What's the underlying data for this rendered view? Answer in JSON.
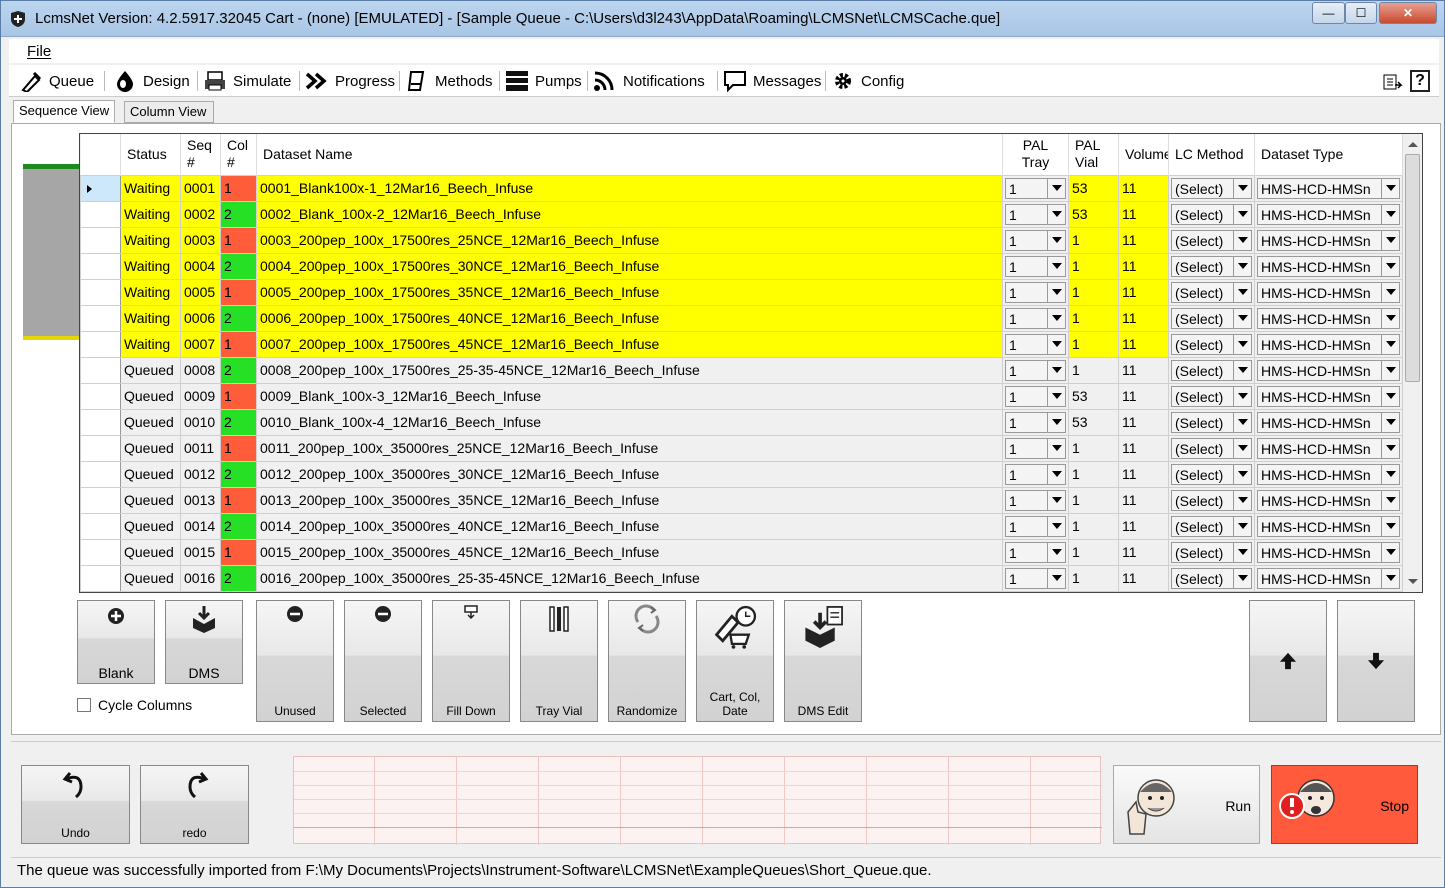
{
  "window": {
    "title": "LcmsNet Version: 4.2.5917.32045 Cart - (none) [EMULATED]  - [Sample Queue - C:\\Users\\d3l243\\AppData\\Roaming\\LCMSNet\\LCMSCache.que]",
    "minimize": "—",
    "maximize": "☐",
    "close": "✕"
  },
  "menu": {
    "file": "File"
  },
  "toolbar": {
    "queue": "Queue",
    "design": "Design",
    "simulate": "Simulate",
    "progress": "Progress",
    "methods": "Methods",
    "pumps": "Pumps",
    "notifications": "Notifications",
    "messages": "Messages",
    "config": "Config",
    "help": "?"
  },
  "tabs": {
    "sequence": "Sequence View",
    "column": "Column View"
  },
  "grid": {
    "headers": {
      "status": "Status",
      "seq": [
        "Seq",
        "#"
      ],
      "col": [
        "Col",
        "#"
      ],
      "dataset": "Dataset Name",
      "pal_tray": [
        "PAL",
        "Tray"
      ],
      "pal_vial": [
        "PAL",
        "Vial"
      ],
      "volume": "Volume",
      "lc_method": "LC Method",
      "dataset_type": "Dataset Type"
    },
    "rows": [
      {
        "status": "Waiting",
        "seq": "0001",
        "col": "1",
        "name": "0001_Blank100x-1_12Mar16_Beech_Infuse",
        "tray": "1",
        "vial": "53",
        "vol": "11",
        "method": "(Select)",
        "type": "HMS-HCD-HMSn"
      },
      {
        "status": "Waiting",
        "seq": "0002",
        "col": "2",
        "name": "0002_Blank_100x-2_12Mar16_Beech_Infuse",
        "tray": "1",
        "vial": "53",
        "vol": "11",
        "method": "(Select)",
        "type": "HMS-HCD-HMSn"
      },
      {
        "status": "Waiting",
        "seq": "0003",
        "col": "1",
        "name": "0003_200pep_100x_17500res_25NCE_12Mar16_Beech_Infuse",
        "tray": "1",
        "vial": "1",
        "vol": "11",
        "method": "(Select)",
        "type": "HMS-HCD-HMSn"
      },
      {
        "status": "Waiting",
        "seq": "0004",
        "col": "2",
        "name": "0004_200pep_100x_17500res_30NCE_12Mar16_Beech_Infuse",
        "tray": "1",
        "vial": "1",
        "vol": "11",
        "method": "(Select)",
        "type": "HMS-HCD-HMSn"
      },
      {
        "status": "Waiting",
        "seq": "0005",
        "col": "1",
        "name": "0005_200pep_100x_17500res_35NCE_12Mar16_Beech_Infuse",
        "tray": "1",
        "vial": "1",
        "vol": "11",
        "method": "(Select)",
        "type": "HMS-HCD-HMSn"
      },
      {
        "status": "Waiting",
        "seq": "0006",
        "col": "2",
        "name": "0006_200pep_100x_17500res_40NCE_12Mar16_Beech_Infuse",
        "tray": "1",
        "vial": "1",
        "vol": "11",
        "method": "(Select)",
        "type": "HMS-HCD-HMSn"
      },
      {
        "status": "Waiting",
        "seq": "0007",
        "col": "1",
        "name": "0007_200pep_100x_17500res_45NCE_12Mar16_Beech_Infuse",
        "tray": "1",
        "vial": "1",
        "vol": "11",
        "method": "(Select)",
        "type": "HMS-HCD-HMSn"
      },
      {
        "status": "Queued",
        "seq": "0008",
        "col": "2",
        "name": "0008_200pep_100x_17500res_25-35-45NCE_12Mar16_Beech_Infuse",
        "tray": "1",
        "vial": "1",
        "vol": "11",
        "method": "(Select)",
        "type": "HMS-HCD-HMSn"
      },
      {
        "status": "Queued",
        "seq": "0009",
        "col": "1",
        "name": "0009_Blank_100x-3_12Mar16_Beech_Infuse",
        "tray": "1",
        "vial": "53",
        "vol": "11",
        "method": "(Select)",
        "type": "HMS-HCD-HMSn"
      },
      {
        "status": "Queued",
        "seq": "0010",
        "col": "2",
        "name": "0010_Blank_100x-4_12Mar16_Beech_Infuse",
        "tray": "1",
        "vial": "53",
        "vol": "11",
        "method": "(Select)",
        "type": "HMS-HCD-HMSn"
      },
      {
        "status": "Queued",
        "seq": "0011",
        "col": "1",
        "name": "0011_200pep_100x_35000res_25NCE_12Mar16_Beech_Infuse",
        "tray": "1",
        "vial": "1",
        "vol": "11",
        "method": "(Select)",
        "type": "HMS-HCD-HMSn"
      },
      {
        "status": "Queued",
        "seq": "0012",
        "col": "2",
        "name": "0012_200pep_100x_35000res_30NCE_12Mar16_Beech_Infuse",
        "tray": "1",
        "vial": "1",
        "vol": "11",
        "method": "(Select)",
        "type": "HMS-HCD-HMSn"
      },
      {
        "status": "Queued",
        "seq": "0013",
        "col": "1",
        "name": "0013_200pep_100x_35000res_35NCE_12Mar16_Beech_Infuse",
        "tray": "1",
        "vial": "1",
        "vol": "11",
        "method": "(Select)",
        "type": "HMS-HCD-HMSn"
      },
      {
        "status": "Queued",
        "seq": "0014",
        "col": "2",
        "name": "0014_200pep_100x_35000res_40NCE_12Mar16_Beech_Infuse",
        "tray": "1",
        "vial": "1",
        "vol": "11",
        "method": "(Select)",
        "type": "HMS-HCD-HMSn"
      },
      {
        "status": "Queued",
        "seq": "0015",
        "col": "1",
        "name": "0015_200pep_100x_35000res_45NCE_12Mar16_Beech_Infuse",
        "tray": "1",
        "vial": "1",
        "vol": "11",
        "method": "(Select)",
        "type": "HMS-HCD-HMSn"
      },
      {
        "status": "Queued",
        "seq": "0016",
        "col": "2",
        "name": "0016_200pep_100x_35000res_25-35-45NCE_12Mar16_Beech_Infuse",
        "tray": "1",
        "vial": "1",
        "vol": "11",
        "method": "(Select)",
        "type": "HMS-HCD-HMSn"
      }
    ]
  },
  "actions": {
    "blank": "Blank",
    "dms": "DMS",
    "unused": "Unused",
    "selected": "Selected",
    "fill_down": "Fill Down",
    "tray_vial": "Tray Vial",
    "randomize": "Randomize",
    "cart_col_date": "Cart, Col, Date",
    "dms_edit": "DMS Edit",
    "cycle_columns": "Cycle Columns"
  },
  "bottom": {
    "undo": "Undo",
    "redo": "redo",
    "run": "Run",
    "stop": "Stop"
  },
  "status_text": "The queue was successfully imported from F:\\My Documents\\Projects\\Instrument-Software\\LCMSNet\\ExampleQueues\\Short_Queue.que.",
  "colors": {
    "waiting": "#ffff00",
    "col1": "#ff5c3a",
    "col2": "#26e026",
    "stop": "#ff5a3c"
  }
}
